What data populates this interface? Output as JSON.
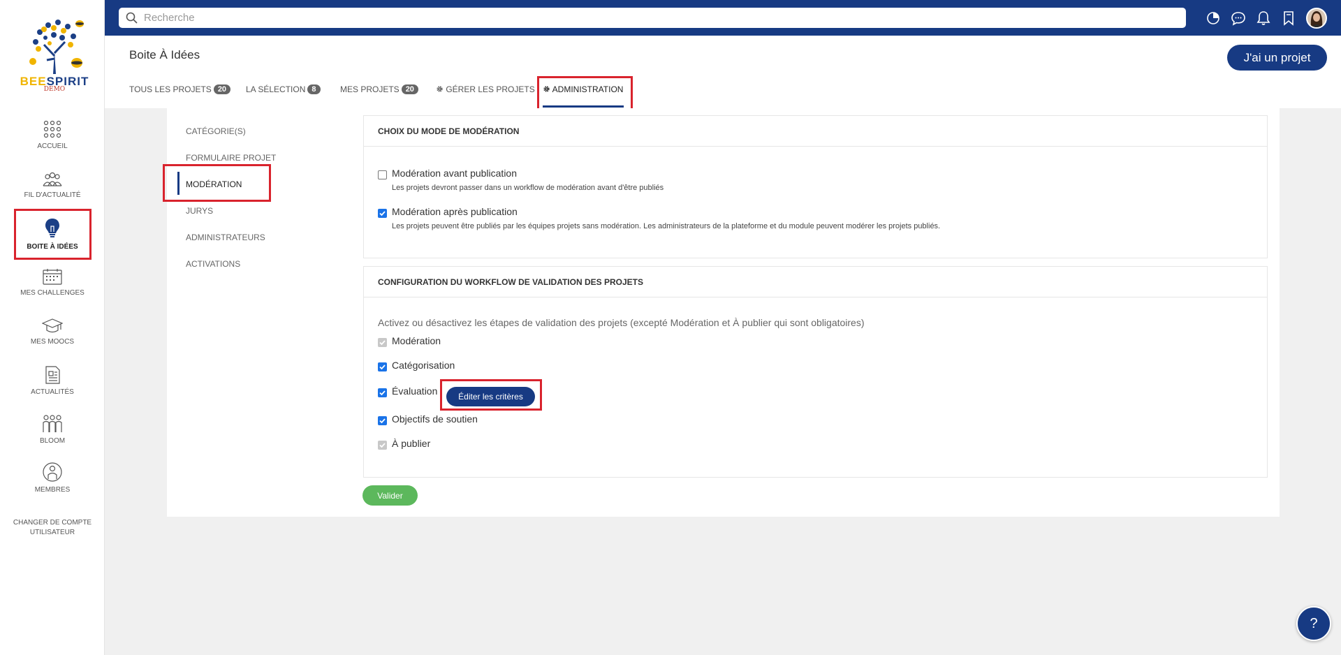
{
  "brand": {
    "logo_text_a": "BEE",
    "logo_text_b": "SPIRIT",
    "logo_sub": "DEMO"
  },
  "sidebar": {
    "items": [
      {
        "label": "ACCUEIL",
        "icon": "grid-dots-icon"
      },
      {
        "label": "FIL D'ACTUALITÉ",
        "icon": "people-group-icon"
      },
      {
        "label": "BOITE À IDÉES",
        "icon": "lightbulb-icon",
        "active": true
      },
      {
        "label": "MES CHALLENGES",
        "icon": "calendar-icon"
      },
      {
        "label": "MES MOOCS",
        "icon": "graduation-cap-icon"
      },
      {
        "label": "ACTUALITÉS",
        "icon": "document-icon"
      },
      {
        "label": "BLOOM",
        "icon": "team-icon"
      },
      {
        "label": "MEMBRES",
        "icon": "member-icon"
      }
    ],
    "switch_account": "CHANGER DE COMPTE UTILISATEUR"
  },
  "search": {
    "placeholder": "Recherche"
  },
  "topbar_icons": [
    "chart-pie-icon",
    "chat-bubble-icon",
    "bell-icon",
    "bookmark-icon",
    "avatar"
  ],
  "header": {
    "title": "Boite À Idées",
    "cta": "J'ai un projet",
    "tabs": [
      {
        "label": "TOUS LES PROJETS",
        "count": "20"
      },
      {
        "label": "LA SÉLECTION",
        "count": "8"
      },
      {
        "label": "MES PROJETS",
        "count": "20"
      },
      {
        "label": "GÉRER LES PROJETS",
        "icon": "gear-icon"
      },
      {
        "label": "ADMINISTRATION",
        "icon": "gear-icon",
        "active": true
      }
    ]
  },
  "subnav": {
    "items": [
      "CATÉGORIE(S)",
      "FORMULAIRE PROJET",
      "MODÉRATION",
      "JURYS",
      "ADMINISTRATEURS",
      "ACTIVATIONS"
    ],
    "active": "MODÉRATION"
  },
  "moderation_panel": {
    "title": "CHOIX DU MODE DE MODÉRATION",
    "options": [
      {
        "label": "Modération avant publication",
        "desc": "Les projets devront passer dans un workflow de modération avant d'être publiés",
        "checked": false
      },
      {
        "label": "Modération après publication",
        "desc": "Les projets peuvent être publiés par les équipes projets sans modération. Les administrateurs de la plateforme et du module peuvent modérer les projets publiés.",
        "checked": true
      }
    ]
  },
  "workflow_panel": {
    "title": "CONFIGURATION DU WORKFLOW DE VALIDATION DES PROJETS",
    "intro": "Activez ou désactivez les étapes de validation des projets (excepté Modération et À publier qui sont obligatoires)",
    "steps": [
      {
        "label": "Modération",
        "state": "disabled-checked"
      },
      {
        "label": "Catégorisation",
        "state": "checked"
      },
      {
        "label": "Évaluation",
        "state": "checked"
      },
      {
        "label": "Objectifs de soutien",
        "state": "checked"
      },
      {
        "label": "À publier",
        "state": "disabled-checked"
      }
    ],
    "edit_button": "Éditer les critères"
  },
  "submit_button": "Valider",
  "help_button": "?",
  "colors": {
    "primary": "#173a83",
    "highlight": "#d9232d",
    "success": "#5cb85c",
    "checkbox": "#1a73e8"
  }
}
